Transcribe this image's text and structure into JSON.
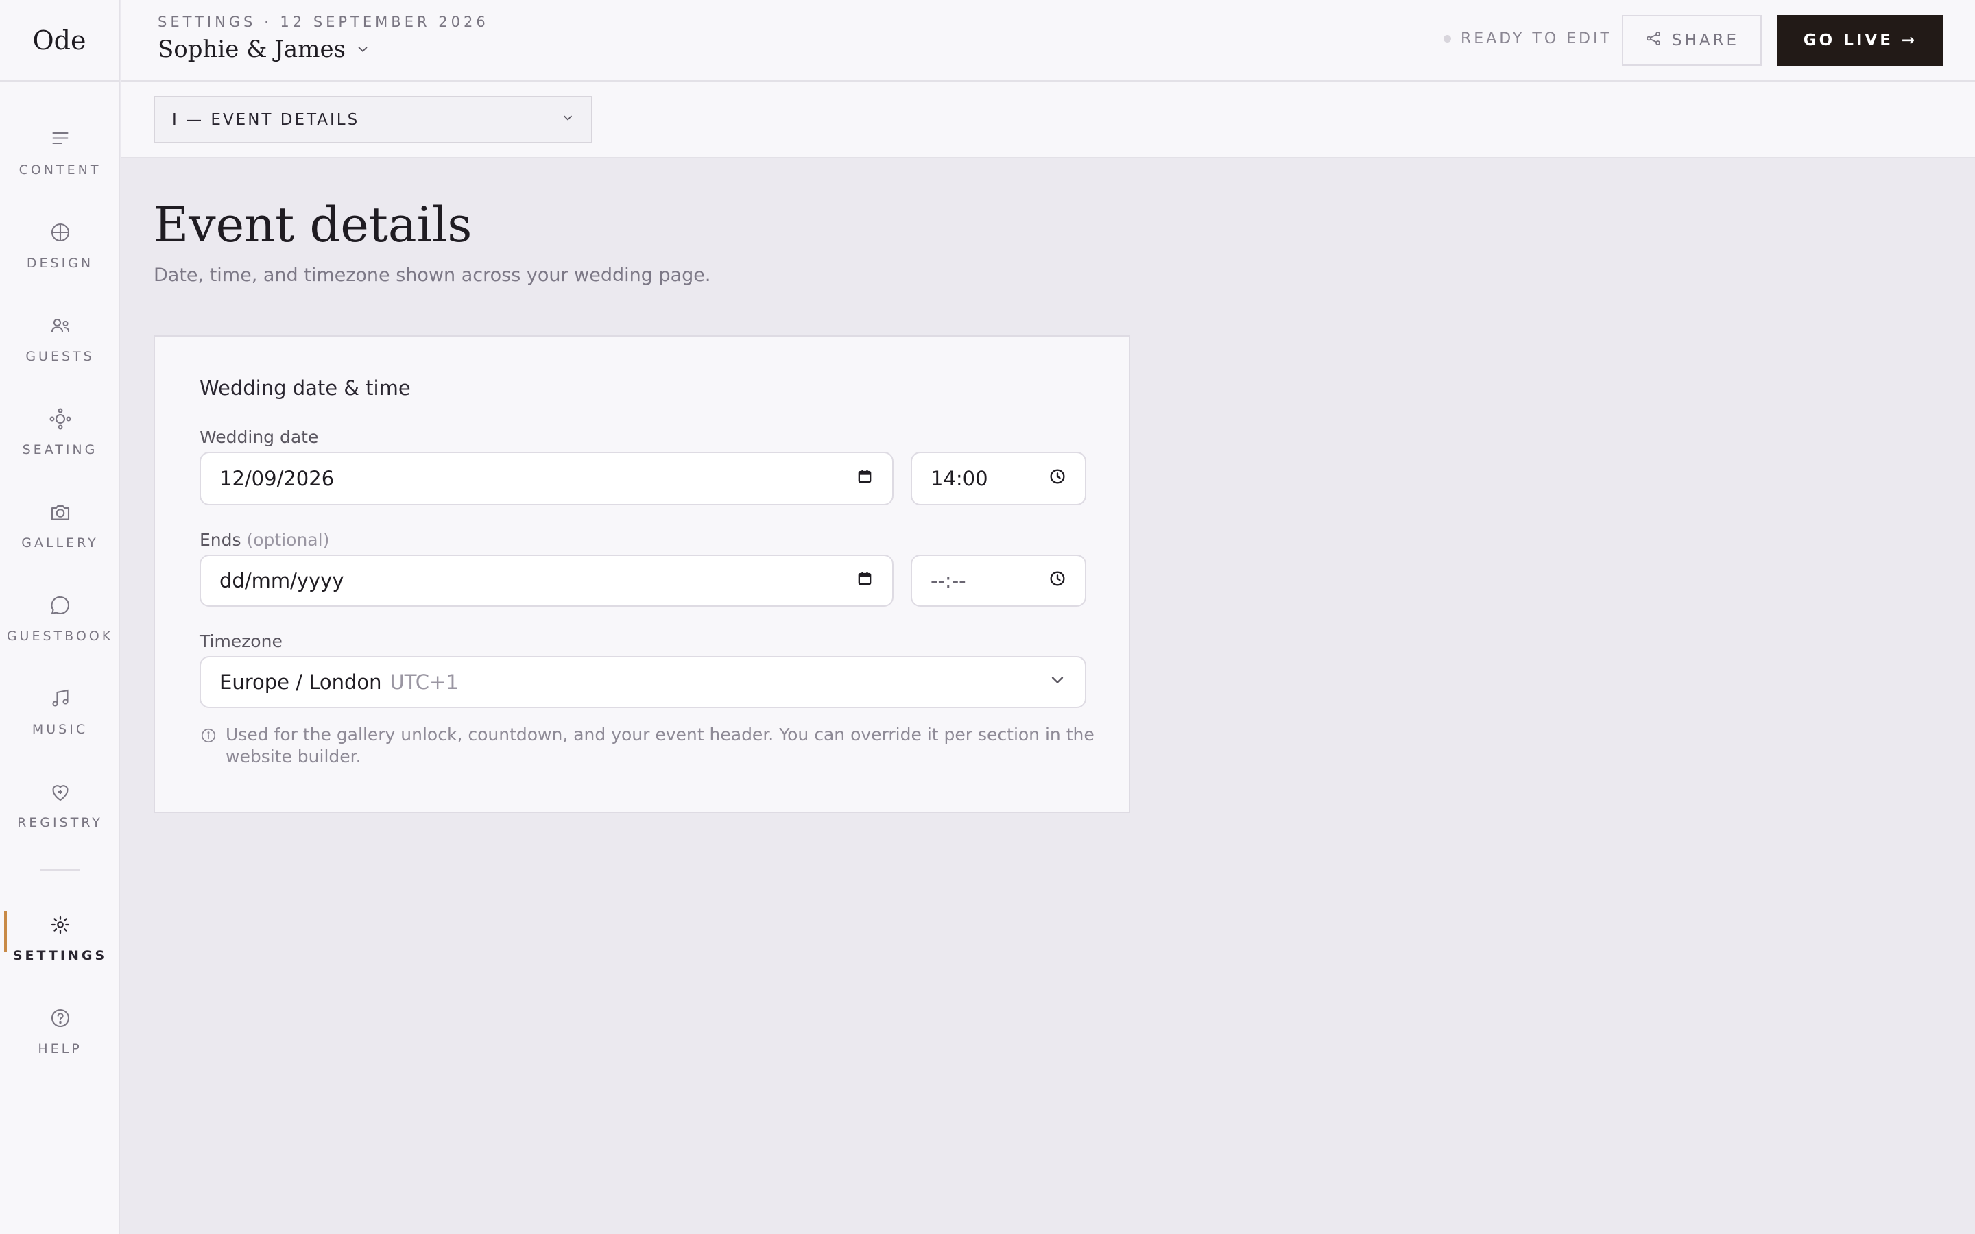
{
  "app": {
    "logo": "Ode"
  },
  "sidebar": {
    "items": [
      {
        "label": "CONTENT",
        "icon": "lines-icon"
      },
      {
        "label": "DESIGN",
        "icon": "compass-icon"
      },
      {
        "label": "GUESTS",
        "icon": "users-icon"
      },
      {
        "label": "SEATING",
        "icon": "seating-icon"
      },
      {
        "label": "GALLERY",
        "icon": "camera-icon"
      },
      {
        "label": "GUESTBOOK",
        "icon": "chat-bubble-icon"
      },
      {
        "label": "MUSIC",
        "icon": "music-note-icon"
      },
      {
        "label": "REGISTRY",
        "icon": "heart-plus-icon"
      },
      {
        "label": "SETTINGS",
        "icon": "gear-icon",
        "active": true
      },
      {
        "label": "HELP",
        "icon": "help-circle-icon"
      }
    ]
  },
  "header": {
    "breadcrumb": "SETTINGS · 12 SEPTEMBER 2026",
    "couple_name": "Sophie & James",
    "status": "READY TO EDIT",
    "share_label": "SHARE",
    "go_live_label": "GO LIVE →"
  },
  "section_select": {
    "value": "I — EVENT DETAILS"
  },
  "main": {
    "title": "Event details",
    "subtitle": "Date, time, and timezone shown across your wedding page."
  },
  "card": {
    "title": "Wedding date & time",
    "wedding_date_label": "Wedding date",
    "wedding_date_value": "12/09/2026",
    "wedding_time_value": "14:00",
    "ends_label": "Ends",
    "ends_optional": "(optional)",
    "ends_date_placeholder": "dd/mm/yyyy",
    "ends_time_placeholder": "--:--",
    "timezone_label": "Timezone",
    "timezone_value": "Europe / London",
    "timezone_offset": "UTC+1",
    "hint": "Used for the gallery unlock, countdown, and your event header. You can override it per section in the website builder."
  },
  "colors": {
    "accent": "#c88a47",
    "primary_button": "#221a17",
    "background": "#ebe9ef",
    "panel": "#f8f7fa"
  }
}
